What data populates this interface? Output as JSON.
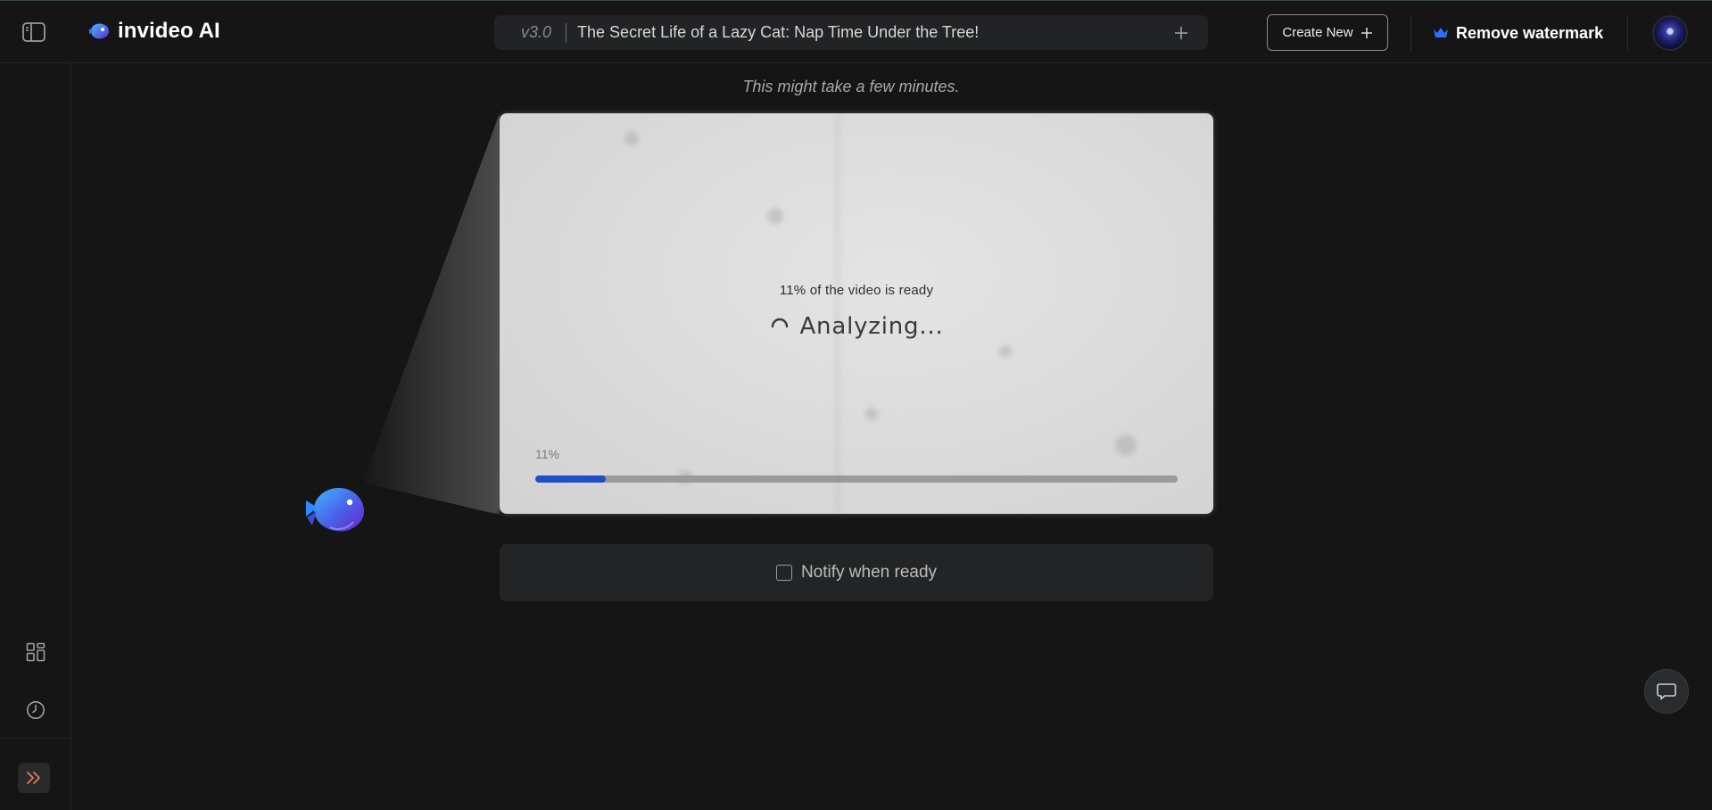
{
  "topbar": {
    "brand_name": "invideo AI",
    "version": "v3.0",
    "project_title": "The Secret Life of a Lazy Cat: Nap Time Under the Tree!",
    "create_new_label": "Create New",
    "remove_watermark_label": "Remove watermark"
  },
  "sidebar": {
    "items": [
      {
        "icon": "grid-icon",
        "label": "Templates"
      },
      {
        "icon": "clock-icon",
        "label": "History"
      }
    ],
    "expand_icon": "double-chevron-right-icon"
  },
  "main": {
    "status_note": "This might take a few minutes.",
    "ready_text": "11% of the video is ready",
    "analyzing_text": "Analyzing...",
    "progress_label": "11%",
    "progress_value": 0.11,
    "notify_label": "Notify when ready",
    "notify_checked": false
  },
  "colors": {
    "background": "#151515",
    "accent_blue": "#1e4fc8",
    "crown_blue": "#2f6fff"
  }
}
